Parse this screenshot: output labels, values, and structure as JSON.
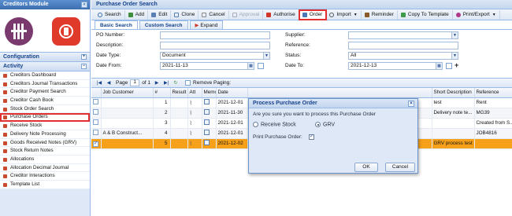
{
  "sidebar": {
    "module_title": "Creditors Module",
    "configuration_label": "Configuration",
    "activity_label": "Activity",
    "items": [
      {
        "label": "Creditors Dashboard"
      },
      {
        "label": "Creditors Journal Transactions"
      },
      {
        "label": "Creditor Payment Search"
      },
      {
        "label": "Creditor Cash Book"
      },
      {
        "label": "Stock Order Search"
      },
      {
        "label": "Purchase Orders"
      },
      {
        "label": "Receive Stock"
      },
      {
        "label": "Delivery Note Processing"
      },
      {
        "label": "Goods Received Notes (GRV)"
      },
      {
        "label": "Stock Return Notes"
      },
      {
        "label": "Allocations"
      },
      {
        "label": "Allocation Decimal Journal"
      },
      {
        "label": "Creditor Interactions"
      },
      {
        "label": "Template List"
      }
    ]
  },
  "main": {
    "title": "Purchase Order Search",
    "toolbar": {
      "search": "Search",
      "add": "Add",
      "edit": "Edit",
      "clone": "Clone",
      "cancel": "Cancel",
      "approval": "Approval",
      "authorise": "Authorise",
      "order": "Order",
      "import": "Import",
      "reminder": "Reminder",
      "copy_to_template": "Copy To Template",
      "print_export": "Print/Export"
    },
    "tabs": {
      "basic": "Basic Search",
      "custom": "Custom Search",
      "expand": "Expand"
    },
    "form": {
      "po_number_label": "PO Number:",
      "description_label": "Description:",
      "date_type_label": "Date Type:",
      "date_type_value": "Document",
      "date_from_label": "Date From:",
      "date_from_value": "2021-11-13",
      "supplier_label": "Supplier:",
      "reference_label": "Reference:",
      "status_label": "Status:",
      "status_value": "All",
      "date_to_label": "Date To:",
      "date_to_value": "2021-12-13"
    },
    "pager": {
      "page_label": "Page",
      "page_value": "1",
      "of_label": "of 1",
      "remove_paging": "Remove Paging:"
    },
    "grid": {
      "columns": [
        "",
        "Job Customer",
        "#",
        "Result",
        "Att",
        "Memo",
        "Date",
        "",
        "Short Description",
        "Reference"
      ],
      "rows": [
        {
          "job": "",
          "num": "1",
          "date": "2021-12-01",
          "desc": "test",
          "ref": "Rent"
        },
        {
          "job": "",
          "num": "2",
          "date": "2021-11-30",
          "desc": "Delivery note te...",
          "ref": "MG39"
        },
        {
          "job": "",
          "num": "3",
          "date": "2021-12-01",
          "desc": "",
          "ref": "Created from S..."
        },
        {
          "job": "A & B Construct...",
          "num": "4",
          "date": "2021-12-01",
          "desc": "",
          "ref": "JOB4816"
        },
        {
          "job": "",
          "num": "5",
          "date": "2021-12-02",
          "desc": "GRV process test",
          "ref": ""
        }
      ]
    }
  },
  "dialog": {
    "title": "Process Purchase Order",
    "question": "Are you sure you want to process this Purchase Order",
    "option_receive": "Receive Stock",
    "option_grv": "GRV",
    "print_label": "Print Purchase Order:",
    "ok": "OK",
    "cancel": "Cancel"
  },
  "colors": {
    "selected_row": "#f7a11a",
    "highlight": "#e0302f",
    "header_blue": "#15428b"
  }
}
